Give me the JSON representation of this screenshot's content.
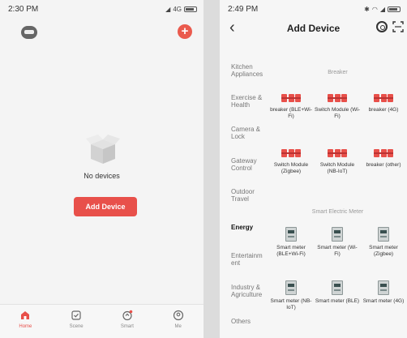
{
  "left": {
    "status": {
      "time": "2:30 PM",
      "signal": "4G"
    },
    "empty_text": "No devices",
    "add_button": "Add Device",
    "tabs": [
      {
        "label": "Home",
        "icon": "home-icon",
        "active": true
      },
      {
        "label": "Scene",
        "icon": "scene-icon",
        "active": false
      },
      {
        "label": "Smart",
        "icon": "smart-icon",
        "active": false
      },
      {
        "label": "Me",
        "icon": "me-icon",
        "active": false
      }
    ]
  },
  "right": {
    "status": {
      "time": "2:49 PM"
    },
    "title": "Add Device",
    "categories": [
      "Kitchen Appliances",
      "Exercise & Health",
      "Camera & Lock",
      "Gateway Control",
      "Outdoor Travel",
      "Energy",
      "Entertainm ent",
      "Industry & Agriculture",
      "Others"
    ],
    "selected_category": "Energy",
    "sections": {
      "breaker": "Breaker",
      "meter": "Smart Electric Meter"
    },
    "breaker_devices": [
      "breaker (BLE+Wi-Fi)",
      "Switch Module (Wi-Fi)",
      "breaker (4G)",
      "Switch Module (Zigbee)",
      "Switch Module (NB-IoT)",
      "breaker (other)"
    ],
    "meter_devices": [
      "Smart meter (BLE+Wi-Fi)",
      "Smart meter (Wi-Fi)",
      "Smart meter (Zigbee)",
      "Smart meter (NB-IoT)",
      "Smart meter (BLE)",
      "Smart meter (4G)"
    ]
  },
  "colors": {
    "accent": "#e8504a",
    "meter": "#cfd4d4"
  }
}
